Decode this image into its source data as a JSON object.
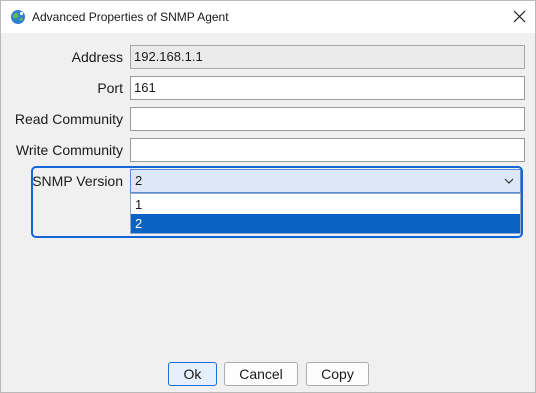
{
  "window": {
    "title": "Advanced Properties of SNMP Agent",
    "app_icon": "network-globe-icon",
    "close_icon": "close-icon"
  },
  "form": {
    "address": {
      "label": "Address",
      "value": "192.168.1.1"
    },
    "port": {
      "label": "Port",
      "value": "161"
    },
    "read_community": {
      "label": "Read Community",
      "value": ""
    },
    "write_community": {
      "label": "Write Community",
      "value": ""
    },
    "snmp_version": {
      "label": "SNMP Version",
      "selected": "2",
      "options": [
        "1",
        "2"
      ],
      "expanded": true
    }
  },
  "buttons": {
    "ok": "Ok",
    "cancel": "Cancel",
    "copy": "Copy"
  },
  "colors": {
    "focus_ring": "#1565d8",
    "selected_option": "#0a63c4"
  }
}
